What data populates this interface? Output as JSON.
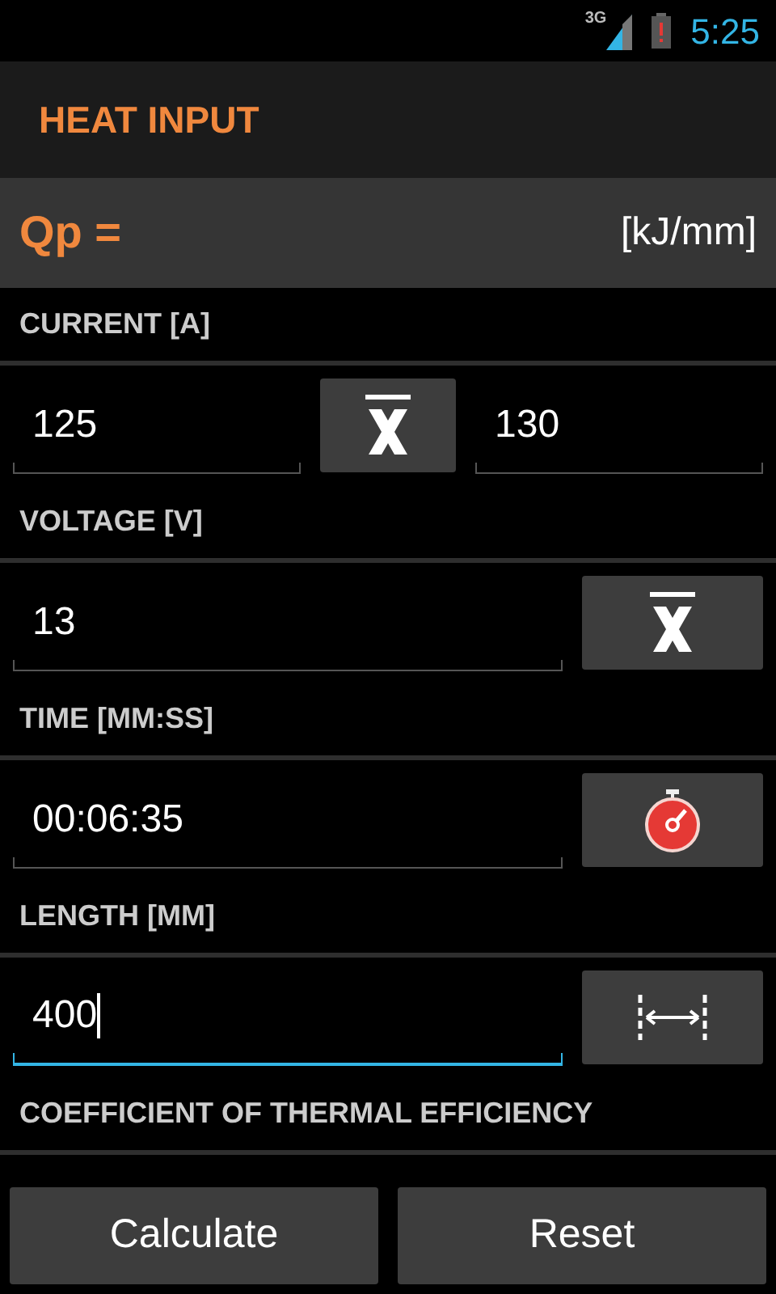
{
  "status_bar": {
    "network": "3G",
    "time": "5:25"
  },
  "title": "HEAT INPUT",
  "result": {
    "label": "Qp =",
    "unit": "[kJ/mm]"
  },
  "sections": [
    {
      "heading": "CURRENT [A]",
      "kind": "split",
      "fields": [
        {
          "value": "125",
          "focused": false
        },
        {
          "value": "130",
          "focused": false
        }
      ],
      "button": {
        "kind": "mean"
      }
    },
    {
      "heading": "VOLTAGE [V]",
      "kind": "single",
      "fields": [
        {
          "value": "13",
          "focused": false
        }
      ],
      "button": {
        "kind": "mean"
      }
    },
    {
      "heading": "TIME [MM:SS]",
      "kind": "single",
      "fields": [
        {
          "value": "00:06:35",
          "focused": false
        }
      ],
      "button": {
        "kind": "stopwatch"
      }
    },
    {
      "heading": "LENGTH [MM]",
      "kind": "single",
      "fields": [
        {
          "value": "400",
          "focused": true
        }
      ],
      "button": {
        "kind": "measure"
      }
    },
    {
      "heading": "COEFFICIENT OF THERMAL EFFICIENCY",
      "kind": "heading"
    }
  ],
  "buttons": [
    "Calculate",
    "Reset"
  ]
}
